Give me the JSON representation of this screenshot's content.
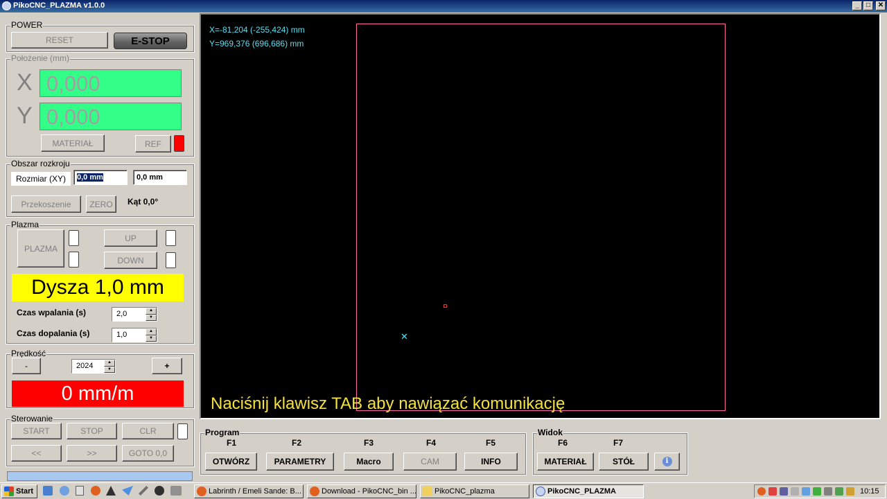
{
  "window": {
    "title": "PikoCNC_PLAZMA v1.0.0",
    "min_label": "_",
    "max_label": "□",
    "close_label": "✕"
  },
  "power": {
    "title": "POWER",
    "reset_label": "RESET",
    "estop_label": "E-STOP"
  },
  "position": {
    "title": "Położenie (mm)",
    "x_letter": "X",
    "x_value": "0,000",
    "y_letter": "Y",
    "y_value": "0,000",
    "material_label": "MATERIAŁ",
    "ref_label": "REF",
    "ref_indicator_color": "#ff0000"
  },
  "cut_area": {
    "title": "Obszar rozkroju",
    "size_label": "Rozmiar (XY)",
    "size_x": "0,0 mm",
    "size_y": "0,0 mm",
    "skew_label": "Przekoszenie",
    "zero_label": "ZERO",
    "angle_label": "Kąt 0,0°"
  },
  "plasma": {
    "title": "Plazma",
    "plasma_label": "PLAZMA",
    "up_label": "UP",
    "down_label": "DOWN",
    "nozzle_text": "Dysza 1,0 mm",
    "nozzle_color": "#ffff00",
    "pierce_label": "Czas wpalania (s)",
    "pierce_value": "2,0",
    "post_label": "Czas dopalania (s)",
    "post_value": "1,0"
  },
  "speed": {
    "title": "Prędkość",
    "minus_label": "-",
    "plus_label": "+",
    "value": "2024",
    "display": "0 mm/m",
    "display_color": "#ff0000"
  },
  "control": {
    "title": "Sterowanie",
    "start_label": "START",
    "stop_label": "STOP",
    "clr_label": "CLR",
    "back_label": "<<",
    "fwd_label": ">>",
    "goto_label": "GOTO 0,0"
  },
  "viewport": {
    "coord_x": "X=-81,204 (-255,424) mm",
    "coord_y": "Y=969,376 (696,686) mm",
    "message": "Naciśnij klawisz TAB aby nawiązać komunikację",
    "table_outline_color": "#ff66aa",
    "cursor_color": "#58e0f0"
  },
  "program": {
    "title": "Program",
    "keys": [
      "F1",
      "F2",
      "F3",
      "F4",
      "F5"
    ],
    "buttons": [
      "OTWÓRZ",
      "PARAMETRY",
      "Macro",
      "CAM",
      "INFO"
    ]
  },
  "view": {
    "title": "Widok",
    "keys": [
      "F6",
      "F7"
    ],
    "buttons": [
      "MATERIAŁ",
      "STÓŁ"
    ],
    "info_icon": "info-icon"
  },
  "taskbar": {
    "start_label": "Start",
    "tasks": [
      "Labrinth / Emeli Sande: B...",
      "Download - PikoCNC_bin ...",
      "PikoCNC_plazma",
      "PikoCNC_PLAZMA"
    ],
    "clock": "10:15"
  }
}
